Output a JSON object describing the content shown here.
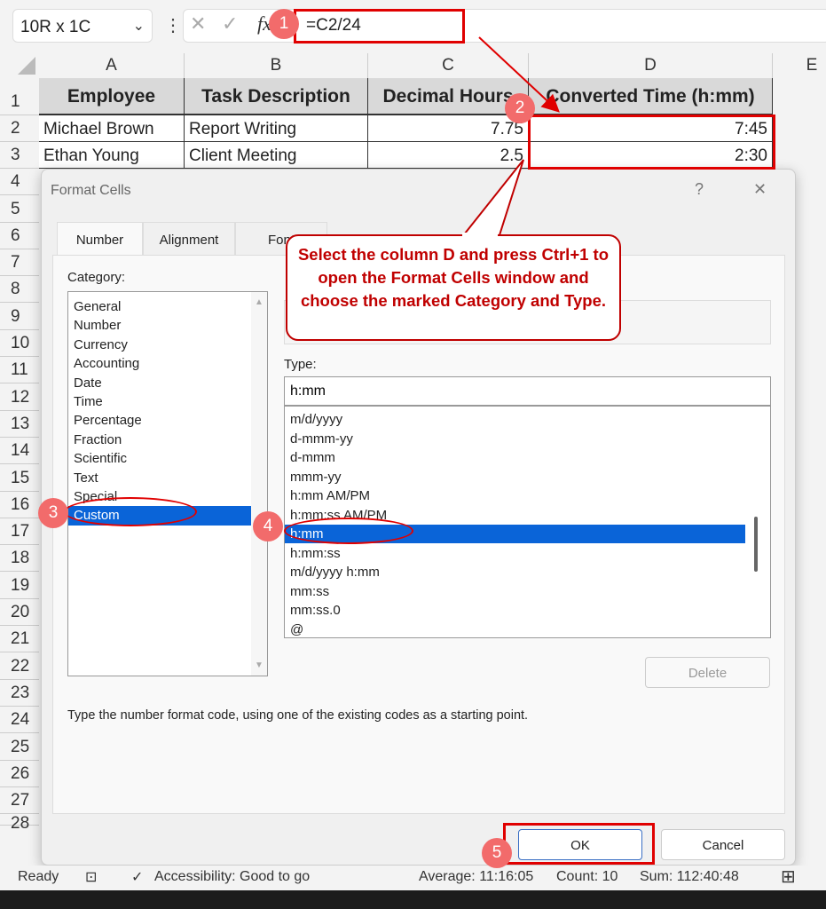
{
  "formula_bar": {
    "name_box": "10R x 1C",
    "formula": "=C2/24",
    "cancel_icon": "x-icon",
    "enter_icon": "check-icon",
    "fx_label": "fx"
  },
  "columns": [
    "A",
    "B",
    "C",
    "D",
    "E"
  ],
  "rows": [
    "1",
    "2",
    "3",
    "4",
    "5",
    "6",
    "7",
    "8",
    "9",
    "10",
    "11",
    "12",
    "13",
    "14",
    "15",
    "16",
    "17",
    "18",
    "19",
    "20",
    "21",
    "22",
    "23",
    "24",
    "25",
    "26",
    "27",
    "28"
  ],
  "table": {
    "headers": [
      "Employee",
      "Task Description",
      "Decimal Hours",
      "Converted Time (h:mm)"
    ],
    "data": [
      [
        "Michael Brown",
        "Report Writing",
        "7.75",
        "7:45"
      ],
      [
        "Ethan Young",
        "Client Meeting",
        "2.5",
        "2:30"
      ]
    ]
  },
  "dialog": {
    "title": "Format Cells",
    "help": "?",
    "close": "✕",
    "tabs": [
      "Number",
      "Alignment",
      "Font"
    ],
    "category_label": "Category:",
    "categories": [
      "General",
      "Number",
      "Currency",
      "Accounting",
      "Date",
      "Time",
      "Percentage",
      "Fraction",
      "Scientific",
      "Text",
      "Special",
      "Custom"
    ],
    "selected_category": "Custom",
    "type_label": "Type:",
    "type_value": "h:mm",
    "types": [
      "m/d/yyyy",
      "d-mmm-yy",
      "d-mmm",
      "mmm-yy",
      "h:mm AM/PM",
      "h:mm:ss AM/PM",
      "h:mm",
      "h:mm:ss",
      "m/d/yyyy h:mm",
      "mm:ss",
      "mm:ss.0",
      "@"
    ],
    "selected_type": "h:mm",
    "delete_label": "Delete",
    "description": "Type the number format code, using one of the existing codes as a starting point.",
    "ok_label": "OK",
    "cancel_label": "Cancel"
  },
  "callout": {
    "text": "Select the column D and press Ctrl+1 to open the Format Cells window and choose the marked Category and Type.",
    "color": "#c00000"
  },
  "badges": [
    "1",
    "2",
    "3",
    "4",
    "5"
  ],
  "status_bar": {
    "ready": "Ready",
    "accessibility": "Accessibility: Good to go",
    "average": "Average: 11:16:05",
    "count": "Count: 10",
    "sum": "Sum: 112:40:48"
  },
  "colors": {
    "selection": "#0a64d8",
    "annotation": "#e00000",
    "badge": "#f26b6b"
  }
}
